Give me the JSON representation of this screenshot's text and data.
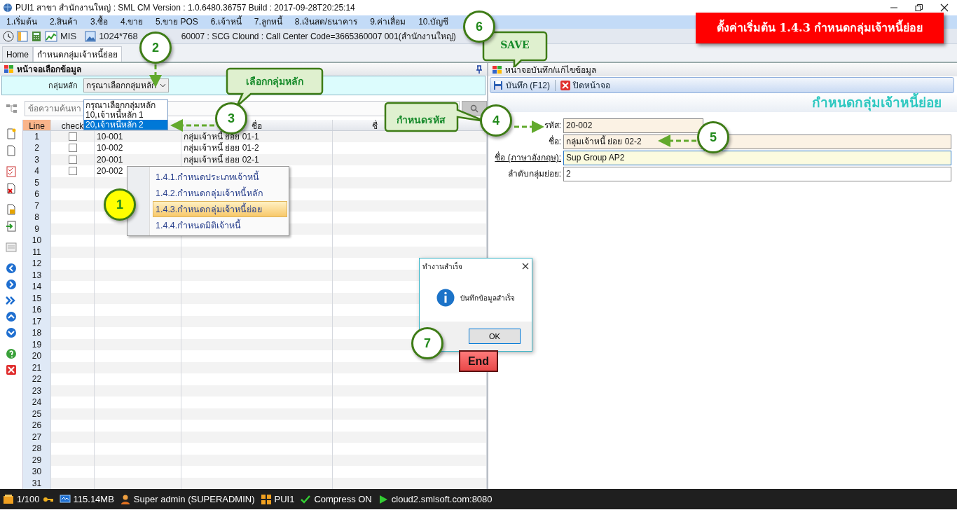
{
  "window": {
    "title": "PUI1 สาขา สำนักงานใหญ่ : SML CM Version : 1.0.6480.36757  Build : 2017-09-28T20:25:14"
  },
  "menu": [
    "1.เริ่มต้น",
    "2.สินค้า",
    "3.ซื้อ",
    "4.ขาย",
    "5.ขาย POS",
    "6.เจ้าหนี้",
    "7.ลูกหนี้",
    "8.เงินสด/ธนาคาร",
    "9.ค่าเสื่อม",
    "10.บัญชี"
  ],
  "toolbar": {
    "mis": "MIS",
    "resolution": "1024*768",
    "info": "60007 : SCG Clound : Call Center Code=3665360007 001(สำนักงานใหญ่)"
  },
  "tabs": [
    {
      "label": "Home",
      "selected": false
    },
    {
      "label": "กำหนดกลุ่มเจ้าหนี้ย่อย",
      "selected": true
    }
  ],
  "left_panel": {
    "title": "หน้าจอเลือกข้อมูล",
    "filter_label": "กลุ่มหลัก",
    "select_value": "กรุณาเลือกกลุ่มหลัก",
    "dropdown_options": [
      {
        "label": "กรุณาเลือกกลุ่มหลัก",
        "selected": false
      },
      {
        "label": "10,เจ้าหนี้หลัก 1",
        "selected": false
      },
      {
        "label": "20,เจ้าหนี้หลัก 2",
        "selected": true
      }
    ],
    "search_placeholder": "ข้อความค้นหา",
    "columns": [
      {
        "label": "Line"
      },
      {
        "label": "check"
      },
      {},
      {
        "label": "ชื่อ"
      },
      {
        "label": "ชื่"
      }
    ],
    "rows": [
      {
        "line": "1",
        "checked": false,
        "code": "10-001",
        "name": "กลุ่มเจ้าหนี้ ย่อย 01-1"
      },
      {
        "line": "2",
        "checked": false,
        "code": "10-002",
        "name": "กลุ่มเจ้าหนี้ ย่อย 01-2"
      },
      {
        "line": "3",
        "checked": false,
        "code": "20-001",
        "name": "กลุ่มเจ้าหนี้ ย่อย 02-1"
      },
      {
        "line": "4",
        "checked": false,
        "code": "20-002"
      },
      {
        "line": "5"
      },
      {
        "line": "6"
      },
      {
        "line": "7"
      },
      {
        "line": "8"
      },
      {
        "line": "9"
      },
      {
        "line": "10"
      },
      {
        "line": "11"
      },
      {
        "line": "12"
      },
      {
        "line": "13"
      },
      {
        "line": "14"
      },
      {
        "line": "15"
      },
      {
        "line": "16"
      },
      {
        "line": "17"
      },
      {
        "line": "18"
      },
      {
        "line": "19"
      },
      {
        "line": "20"
      },
      {
        "line": "21"
      },
      {
        "line": "22"
      },
      {
        "line": "23"
      },
      {
        "line": "24"
      },
      {
        "line": "25"
      },
      {
        "line": "26"
      },
      {
        "line": "27"
      },
      {
        "line": "28"
      },
      {
        "line": "29"
      },
      {
        "line": "30"
      },
      {
        "line": "31"
      }
    ]
  },
  "context_menu": {
    "items": [
      {
        "label": "1.4.1.กำหนดประเภทเจ้าหนี้",
        "selected": false
      },
      {
        "label": "1.4.2.กำหนดกลุ่มเจ้าหนี้หลัก",
        "selected": false
      },
      {
        "label": "1.4.3.กำหนดกลุ่มเจ้าหนี้ย่อย",
        "selected": true
      },
      {
        "label": "1.4.4.กำหนดมิติเจ้าหนี้",
        "selected": false
      }
    ]
  },
  "right_panel": {
    "title": "หน้าจอบันทึก/แก้ไขข้อมูล",
    "buttons": [
      {
        "kind": "save",
        "label": "บันทึก (F12)"
      },
      {
        "kind": "close",
        "label": "ปิดหน้าจอ"
      }
    ],
    "heading": "กำหนดกลุ่มเจ้าหนี้ย่อย",
    "fields": [
      {
        "label": "รหัส:",
        "value": "20-002",
        "kind": "short",
        "focused": false
      },
      {
        "label": "ชื่อ:",
        "value": "กลุ่มเจ้าหนี้ ย่อย 02-2",
        "kind": "wide",
        "focused": false
      },
      {
        "label": "ชื่อ (ภาษาอังกฤษ):",
        "value": "Sup Group AP2",
        "kind": "wide",
        "focused": true
      },
      {
        "label": "ลำดับกลุ่มย่อย:",
        "value": "2",
        "kind": "plain",
        "focused": false
      }
    ]
  },
  "dialog": {
    "title": "ทำงานสำเร็จ",
    "message": "บันทึกข้อมูลสำเร็จ",
    "button": "OK"
  },
  "banner": "ตั้งค่าเริ่มต้น 1.4.3 กำหนดกลุ่มเจ้าหนี้ย่อย",
  "steps": [
    {
      "number": "1",
      "color": "#ffff00"
    },
    {
      "number": "2",
      "color": "#ffffff"
    },
    {
      "number": "3",
      "color": "#ffffff"
    },
    {
      "number": "4",
      "color": "#ffffff"
    },
    {
      "number": "5",
      "color": "#ffffff"
    },
    {
      "number": "6",
      "color": "#ffffff"
    },
    {
      "number": "7",
      "color": "#ffffff"
    }
  ],
  "callouts": [
    "เลือกกลุ่มหลัก",
    "กำหนดรหัส",
    "SAVE"
  ],
  "end_label": "End",
  "status_bar": [
    {
      "kind": "page",
      "text": "1/100"
    },
    {
      "kind": "memory",
      "text": "115.14MB"
    },
    {
      "kind": "user",
      "text": "Super admin (SUPERADMIN)"
    },
    {
      "kind": "database",
      "text": "PUI1"
    },
    {
      "kind": "compress",
      "text": "Compress ON"
    },
    {
      "kind": "server",
      "text": "cloud2.smlsoft.com:8080"
    }
  ]
}
